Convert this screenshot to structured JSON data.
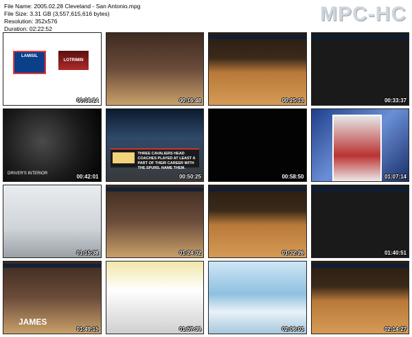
{
  "file_info": {
    "name_line": "File Name: 2005.02.28 Cleveland - San Antonio.mpg",
    "size_line": "File Size: 3.31 GB (3,557,615,616 bytes)",
    "resolution_line": "Resolution: 352x576",
    "duration_line": "Duration: 02:22:52"
  },
  "app_logo": "MPC-HC",
  "thumbnails": [
    {
      "timestamp": "00:08:24",
      "ad_text_1": "LAMISIL",
      "ad_text_2": "LOTRIMIN"
    },
    {
      "timestamp": "00:16:48"
    },
    {
      "timestamp": "00:25:13"
    },
    {
      "timestamp": "00:33:37"
    },
    {
      "timestamp": "00:42:01",
      "caption": "DRIVER'S INTERIOR"
    },
    {
      "timestamp": "00:50:25",
      "caption": "THREE CAVALIERS HEAD COACHES PLAYED AT LEAST A PART OF THEIR CAREER WITH THE SPURS. NAME THEM.",
      "badge": "TRIVIA QUESTION"
    },
    {
      "timestamp": "00:58:50"
    },
    {
      "timestamp": "01:07:14"
    },
    {
      "timestamp": "01:15:38"
    },
    {
      "timestamp": "01:24:02"
    },
    {
      "timestamp": "01:32:26"
    },
    {
      "timestamp": "01:40:51"
    },
    {
      "timestamp": "01:49:15",
      "caption": "JAMES"
    },
    {
      "timestamp": "01:57:39"
    },
    {
      "timestamp": "02:06:03"
    },
    {
      "timestamp": "02:14:27"
    }
  ]
}
